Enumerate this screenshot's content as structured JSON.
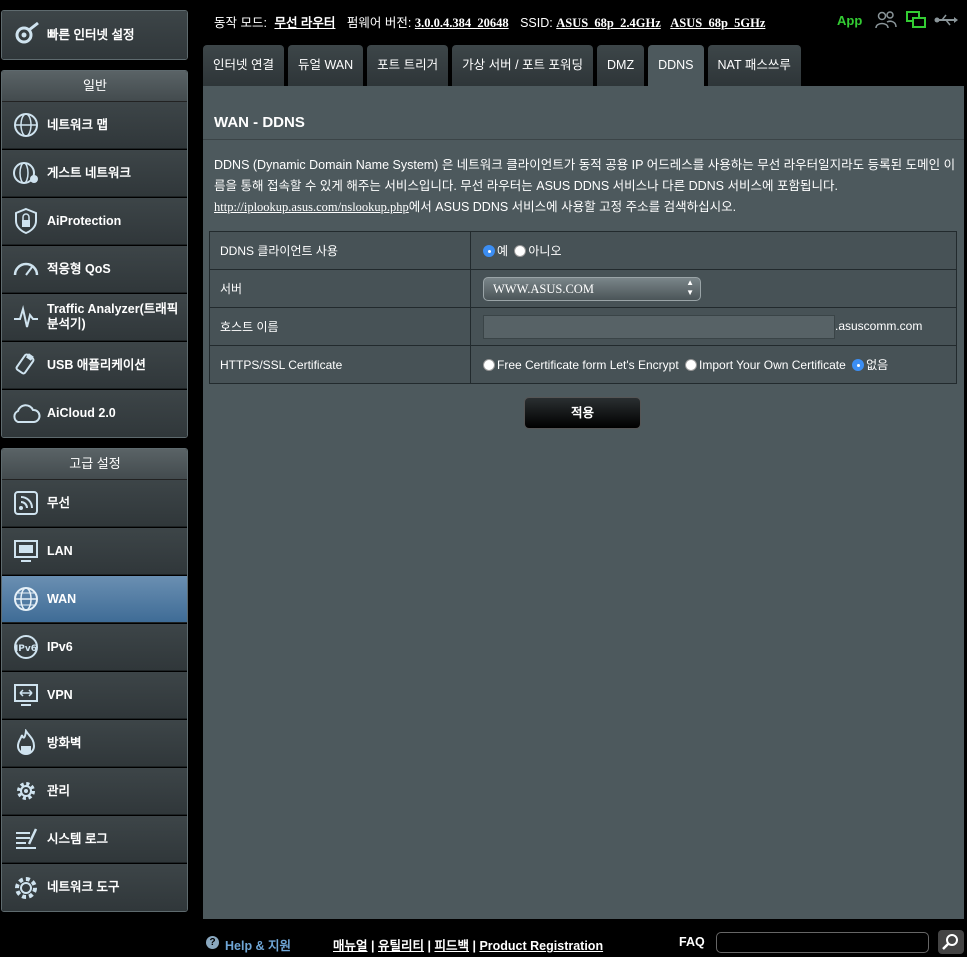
{
  "quick_setup": {
    "label": "빠른 인터넷 설정"
  },
  "general": {
    "header": "일반",
    "items": [
      {
        "label": "네트워크 맵"
      },
      {
        "label": "게스트 네트워크"
      },
      {
        "label": "AiProtection"
      },
      {
        "label": "적응형 QoS"
      },
      {
        "label": "Traffic Analyzer(트래픽분석기)"
      },
      {
        "label": "USB 애플리케이션"
      },
      {
        "label": "AiCloud 2.0"
      }
    ]
  },
  "advanced": {
    "header": "고급 설정",
    "items": [
      {
        "label": "무선"
      },
      {
        "label": "LAN"
      },
      {
        "label": "WAN"
      },
      {
        "label": "IPv6"
      },
      {
        "label": "VPN"
      },
      {
        "label": "방화벽"
      },
      {
        "label": "관리"
      },
      {
        "label": "시스템 로그"
      },
      {
        "label": "네트워크 도구"
      }
    ]
  },
  "topbar": {
    "mode_label": "동작 모드:",
    "mode_value": "무선 라우터",
    "firmware_label": "펌웨어 버전:",
    "firmware_value": "3.0.0.4.384_20648",
    "ssid_label": "SSID:",
    "ssid_24": "ASUS_68p_2.4GHz",
    "ssid_5": "ASUS_68p_5GHz",
    "app_label": "App"
  },
  "tabs": [
    {
      "label": "인터넷 연결"
    },
    {
      "label": "듀얼 WAN"
    },
    {
      "label": "포트 트리거"
    },
    {
      "label": "가상 서버 / 포트 포워딩"
    },
    {
      "label": "DMZ"
    },
    {
      "label": "DDNS"
    },
    {
      "label": "NAT 패스쓰루"
    }
  ],
  "panel": {
    "title": "WAN - DDNS",
    "description": "DDNS (Dynamic Domain Name System) 은 네트워크 클라이언트가 동적 공용 IP 어드레스를 사용하는 무선 라우터일지라도 등록된 도메인 이름을 통해 접속할 수 있게 해주는 서비스입니다. 무선 라우터는 ASUS DDNS 서비스나 다른 DDNS 서비스에 포함됩니다.",
    "lookup_link": "http://iplookup.asus.com/nslookup.php",
    "lookup_text": "에서 ASUS DDNS 서비스에 사용할 고정 주소를 검색하십시오.",
    "rows": {
      "enable_label": "DDNS 클라이언트 사용",
      "enable_yes": "예",
      "enable_no": "아니오",
      "server_label": "서버",
      "server_value": "WWW.ASUS.COM",
      "host_label": "호스트 이름",
      "host_value": "",
      "host_suffix": ".asuscomm.com",
      "cert_label": "HTTPS/SSL Certificate",
      "cert_opt1": "Free Certificate form Let's Encrypt",
      "cert_opt2": "Import Your Own Certificate",
      "cert_opt3": "없음"
    },
    "apply_label": "적용"
  },
  "footer": {
    "help": "Help & 지원",
    "manual": "매뉴얼",
    "utility": "유틸리티",
    "feedback": "피드백",
    "registration": "Product Registration",
    "faq": "FAQ",
    "sep": "|"
  },
  "colors": {
    "accent_green": "#33cc33",
    "active_blue": "#3f6c96",
    "panel_bg": "#4d595d"
  }
}
